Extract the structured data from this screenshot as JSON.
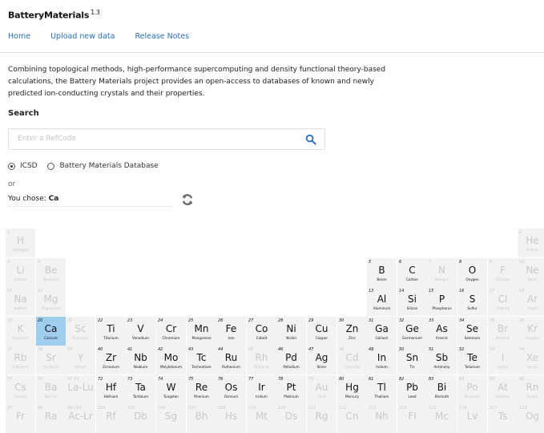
{
  "brand": {
    "name": "BatteryMaterials",
    "version": "1.3"
  },
  "nav": [
    {
      "label": "Home"
    },
    {
      "label": "Upload new data"
    },
    {
      "label": "Release Notes"
    }
  ],
  "intro": "Combining topological methods, high-performance supercomputing and density functional theory-based calculations, the Battery Materials project provides an open-access to databases of known and newly predicted ion-conducting crystals and their properties.",
  "search": {
    "heading": "Search",
    "placeholder": "Enter a RefCode",
    "value": ""
  },
  "radios": [
    {
      "label": "ICSD",
      "checked": true
    },
    {
      "label": "Battery Materials Database",
      "checked": false
    }
  ],
  "or_label": "or",
  "chose": {
    "label": "You chose:",
    "value": "Ca"
  },
  "elements": [
    {
      "n": "1",
      "s": "H",
      "nm": "Hydrogen",
      "r": 1,
      "c": 1,
      "st": "pale"
    },
    {
      "n": "2",
      "s": "He",
      "nm": "Helium",
      "r": 1,
      "c": 18,
      "st": "pale"
    },
    {
      "n": "3",
      "s": "Li",
      "nm": "Lithium",
      "r": 2,
      "c": 1,
      "st": "pale"
    },
    {
      "n": "4",
      "s": "Be",
      "nm": "Beryllium",
      "r": 2,
      "c": 2,
      "st": "pale"
    },
    {
      "n": "5",
      "s": "B",
      "nm": "Boron",
      "r": 2,
      "c": 13,
      "st": "avail"
    },
    {
      "n": "6",
      "s": "C",
      "nm": "Carbon",
      "r": 2,
      "c": 14,
      "st": "avail"
    },
    {
      "n": "7",
      "s": "N",
      "nm": "Nitrogen",
      "r": 2,
      "c": 15,
      "st": "pale"
    },
    {
      "n": "8",
      "s": "O",
      "nm": "Oxygen",
      "r": 2,
      "c": 16,
      "st": "avail"
    },
    {
      "n": "9",
      "s": "F",
      "nm": "Fluorine",
      "r": 2,
      "c": 17,
      "st": "pale"
    },
    {
      "n": "10",
      "s": "Ne",
      "nm": "Neon",
      "r": 2,
      "c": 18,
      "st": "pale"
    },
    {
      "n": "11",
      "s": "Na",
      "nm": "Sodium",
      "r": 3,
      "c": 1,
      "st": "pale"
    },
    {
      "n": "12",
      "s": "Mg",
      "nm": "Magnesium",
      "r": 3,
      "c": 2,
      "st": "pale"
    },
    {
      "n": "13",
      "s": "Al",
      "nm": "Aluminum",
      "r": 3,
      "c": 13,
      "st": "avail"
    },
    {
      "n": "14",
      "s": "Si",
      "nm": "Silicon",
      "r": 3,
      "c": 14,
      "st": "avail"
    },
    {
      "n": "15",
      "s": "P",
      "nm": "Phosphorus",
      "r": 3,
      "c": 15,
      "st": "avail"
    },
    {
      "n": "16",
      "s": "S",
      "nm": "Sulfur",
      "r": 3,
      "c": 16,
      "st": "avail"
    },
    {
      "n": "17",
      "s": "Cl",
      "nm": "Chlorine",
      "r": 3,
      "c": 17,
      "st": "pale"
    },
    {
      "n": "18",
      "s": "Ar",
      "nm": "Argon",
      "r": 3,
      "c": 18,
      "st": "pale"
    },
    {
      "n": "19",
      "s": "K",
      "nm": "Potassium",
      "r": 4,
      "c": 1,
      "st": "pale"
    },
    {
      "n": "20",
      "s": "Ca",
      "nm": "Calcium",
      "r": 4,
      "c": 2,
      "st": "sel"
    },
    {
      "n": "21",
      "s": "Sc",
      "nm": "Scandium",
      "r": 4,
      "c": 3,
      "st": "pale"
    },
    {
      "n": "22",
      "s": "Ti",
      "nm": "Titanium",
      "r": 4,
      "c": 4,
      "st": "avail"
    },
    {
      "n": "23",
      "s": "V",
      "nm": "Vanadium",
      "r": 4,
      "c": 5,
      "st": "avail"
    },
    {
      "n": "24",
      "s": "Cr",
      "nm": "Chromium",
      "r": 4,
      "c": 6,
      "st": "avail"
    },
    {
      "n": "25",
      "s": "Mn",
      "nm": "Manganese",
      "r": 4,
      "c": 7,
      "st": "avail"
    },
    {
      "n": "26",
      "s": "Fe",
      "nm": "Iron",
      "r": 4,
      "c": 8,
      "st": "avail"
    },
    {
      "n": "27",
      "s": "Co",
      "nm": "Cobalt",
      "r": 4,
      "c": 9,
      "st": "avail"
    },
    {
      "n": "28",
      "s": "Ni",
      "nm": "Nickel",
      "r": 4,
      "c": 10,
      "st": "avail"
    },
    {
      "n": "29",
      "s": "Cu",
      "nm": "Copper",
      "r": 4,
      "c": 11,
      "st": "avail"
    },
    {
      "n": "30",
      "s": "Zn",
      "nm": "Zinc",
      "r": 4,
      "c": 12,
      "st": "avail"
    },
    {
      "n": "31",
      "s": "Ga",
      "nm": "Gallium",
      "r": 4,
      "c": 13,
      "st": "avail"
    },
    {
      "n": "32",
      "s": "Ge",
      "nm": "Germanium",
      "r": 4,
      "c": 14,
      "st": "avail"
    },
    {
      "n": "33",
      "s": "As",
      "nm": "Arsenic",
      "r": 4,
      "c": 15,
      "st": "avail"
    },
    {
      "n": "34",
      "s": "Se",
      "nm": "Selenium",
      "r": 4,
      "c": 16,
      "st": "avail"
    },
    {
      "n": "35",
      "s": "Br",
      "nm": "Bromine",
      "r": 4,
      "c": 17,
      "st": "pale"
    },
    {
      "n": "36",
      "s": "Kr",
      "nm": "Krypton",
      "r": 4,
      "c": 18,
      "st": "pale"
    },
    {
      "n": "37",
      "s": "Rb",
      "nm": "Rubidium",
      "r": 5,
      "c": 1,
      "st": "pale"
    },
    {
      "n": "38",
      "s": "Sr",
      "nm": "Strontium",
      "r": 5,
      "c": 2,
      "st": "pale"
    },
    {
      "n": "39",
      "s": "Y",
      "nm": "Yttrium",
      "r": 5,
      "c": 3,
      "st": "pale"
    },
    {
      "n": "40",
      "s": "Zr",
      "nm": "Zirconium",
      "r": 5,
      "c": 4,
      "st": "avail"
    },
    {
      "n": "41",
      "s": "Nb",
      "nm": "Niobium",
      "r": 5,
      "c": 5,
      "st": "avail"
    },
    {
      "n": "42",
      "s": "Mo",
      "nm": "Molybdenum",
      "r": 5,
      "c": 6,
      "st": "avail"
    },
    {
      "n": "43",
      "s": "Tc",
      "nm": "Technetium",
      "r": 5,
      "c": 7,
      "st": "avail"
    },
    {
      "n": "44",
      "s": "Ru",
      "nm": "Ruthenium",
      "r": 5,
      "c": 8,
      "st": "avail"
    },
    {
      "n": "45",
      "s": "Rh",
      "nm": "Rhodium",
      "r": 5,
      "c": 9,
      "st": "pale"
    },
    {
      "n": "46",
      "s": "Pd",
      "nm": "Palladium",
      "r": 5,
      "c": 10,
      "st": "avail"
    },
    {
      "n": "47",
      "s": "Ag",
      "nm": "Silver",
      "r": 5,
      "c": 11,
      "st": "avail"
    },
    {
      "n": "48",
      "s": "Cd",
      "nm": "Cadmium",
      "r": 5,
      "c": 12,
      "st": "pale"
    },
    {
      "n": "49",
      "s": "In",
      "nm": "Indium",
      "r": 5,
      "c": 13,
      "st": "avail"
    },
    {
      "n": "50",
      "s": "Sn",
      "nm": "Tin",
      "r": 5,
      "c": 14,
      "st": "avail"
    },
    {
      "n": "51",
      "s": "Sb",
      "nm": "Antimony",
      "r": 5,
      "c": 15,
      "st": "avail"
    },
    {
      "n": "52",
      "s": "Te",
      "nm": "Tellurium",
      "r": 5,
      "c": 16,
      "st": "avail"
    },
    {
      "n": "53",
      "s": "I",
      "nm": "Iodine",
      "r": 5,
      "c": 17,
      "st": "pale"
    },
    {
      "n": "54",
      "s": "Xe",
      "nm": "Xenon",
      "r": 5,
      "c": 18,
      "st": "pale"
    },
    {
      "n": "55",
      "s": "Cs",
      "nm": "Cesium",
      "r": 6,
      "c": 1,
      "st": "pale"
    },
    {
      "n": "56",
      "s": "Ba",
      "nm": "Barium",
      "r": 6,
      "c": 2,
      "st": "pale"
    },
    {
      "n": "57-71",
      "s": "La-Lu",
      "nm": "",
      "r": 6,
      "c": 3,
      "st": "pale"
    },
    {
      "n": "72",
      "s": "Hf",
      "nm": "Hafnium",
      "r": 6,
      "c": 4,
      "st": "avail"
    },
    {
      "n": "73",
      "s": "Ta",
      "nm": "Tantalum",
      "r": 6,
      "c": 5,
      "st": "avail"
    },
    {
      "n": "74",
      "s": "W",
      "nm": "Tungsten",
      "r": 6,
      "c": 6,
      "st": "avail"
    },
    {
      "n": "75",
      "s": "Re",
      "nm": "Rhenium",
      "r": 6,
      "c": 7,
      "st": "avail"
    },
    {
      "n": "76",
      "s": "Os",
      "nm": "Osmium",
      "r": 6,
      "c": 8,
      "st": "avail"
    },
    {
      "n": "77",
      "s": "Ir",
      "nm": "Iridium",
      "r": 6,
      "c": 9,
      "st": "avail"
    },
    {
      "n": "78",
      "s": "Pt",
      "nm": "Platinum",
      "r": 6,
      "c": 10,
      "st": "avail"
    },
    {
      "n": "79",
      "s": "Au",
      "nm": "Gold",
      "r": 6,
      "c": 11,
      "st": "pale"
    },
    {
      "n": "80",
      "s": "Hg",
      "nm": "Mercury",
      "r": 6,
      "c": 12,
      "st": "avail"
    },
    {
      "n": "81",
      "s": "Tl",
      "nm": "Thallium",
      "r": 6,
      "c": 13,
      "st": "avail"
    },
    {
      "n": "82",
      "s": "Pb",
      "nm": "Lead",
      "r": 6,
      "c": 14,
      "st": "avail"
    },
    {
      "n": "83",
      "s": "Bi",
      "nm": "Bismuth",
      "r": 6,
      "c": 15,
      "st": "avail"
    },
    {
      "n": "84",
      "s": "Po",
      "nm": "Polonium",
      "r": 6,
      "c": 16,
      "st": "pale"
    },
    {
      "n": "85",
      "s": "At",
      "nm": "Astatine",
      "r": 6,
      "c": 17,
      "st": "pale"
    },
    {
      "n": "86",
      "s": "Rn",
      "nm": "Radon",
      "r": 6,
      "c": 18,
      "st": "pale"
    },
    {
      "n": "87",
      "s": "Fr",
      "nm": "",
      "r": 7,
      "c": 1,
      "st": "pale"
    },
    {
      "n": "88",
      "s": "Ra",
      "nm": "",
      "r": 7,
      "c": 2,
      "st": "pale"
    },
    {
      "n": "89-103",
      "s": "Ac-Lr",
      "nm": "",
      "r": 7,
      "c": 3,
      "st": "pale"
    },
    {
      "n": "104",
      "s": "Rf",
      "nm": "",
      "r": 7,
      "c": 4,
      "st": "pale"
    },
    {
      "n": "105",
      "s": "Db",
      "nm": "",
      "r": 7,
      "c": 5,
      "st": "pale"
    },
    {
      "n": "106",
      "s": "Sg",
      "nm": "",
      "r": 7,
      "c": 6,
      "st": "pale"
    },
    {
      "n": "107",
      "s": "Bh",
      "nm": "",
      "r": 7,
      "c": 7,
      "st": "pale"
    },
    {
      "n": "108",
      "s": "Hs",
      "nm": "",
      "r": 7,
      "c": 8,
      "st": "pale"
    },
    {
      "n": "109",
      "s": "Mt",
      "nm": "",
      "r": 7,
      "c": 9,
      "st": "pale"
    },
    {
      "n": "110",
      "s": "Ds",
      "nm": "",
      "r": 7,
      "c": 10,
      "st": "pale"
    },
    {
      "n": "111",
      "s": "Rg",
      "nm": "",
      "r": 7,
      "c": 11,
      "st": "pale"
    },
    {
      "n": "112",
      "s": "Cn",
      "nm": "",
      "r": 7,
      "c": 12,
      "st": "pale"
    },
    {
      "n": "113",
      "s": "Nh",
      "nm": "",
      "r": 7,
      "c": 13,
      "st": "pale"
    },
    {
      "n": "114",
      "s": "Fl",
      "nm": "",
      "r": 7,
      "c": 14,
      "st": "pale"
    },
    {
      "n": "115",
      "s": "Mc",
      "nm": "",
      "r": 7,
      "c": 15,
      "st": "pale"
    },
    {
      "n": "116",
      "s": "Lv",
      "nm": "",
      "r": 7,
      "c": 16,
      "st": "pale"
    },
    {
      "n": "117",
      "s": "Ts",
      "nm": "",
      "r": 7,
      "c": 17,
      "st": "pale"
    },
    {
      "n": "118",
      "s": "Og",
      "nm": "",
      "r": 7,
      "c": 18,
      "st": "pale"
    }
  ]
}
